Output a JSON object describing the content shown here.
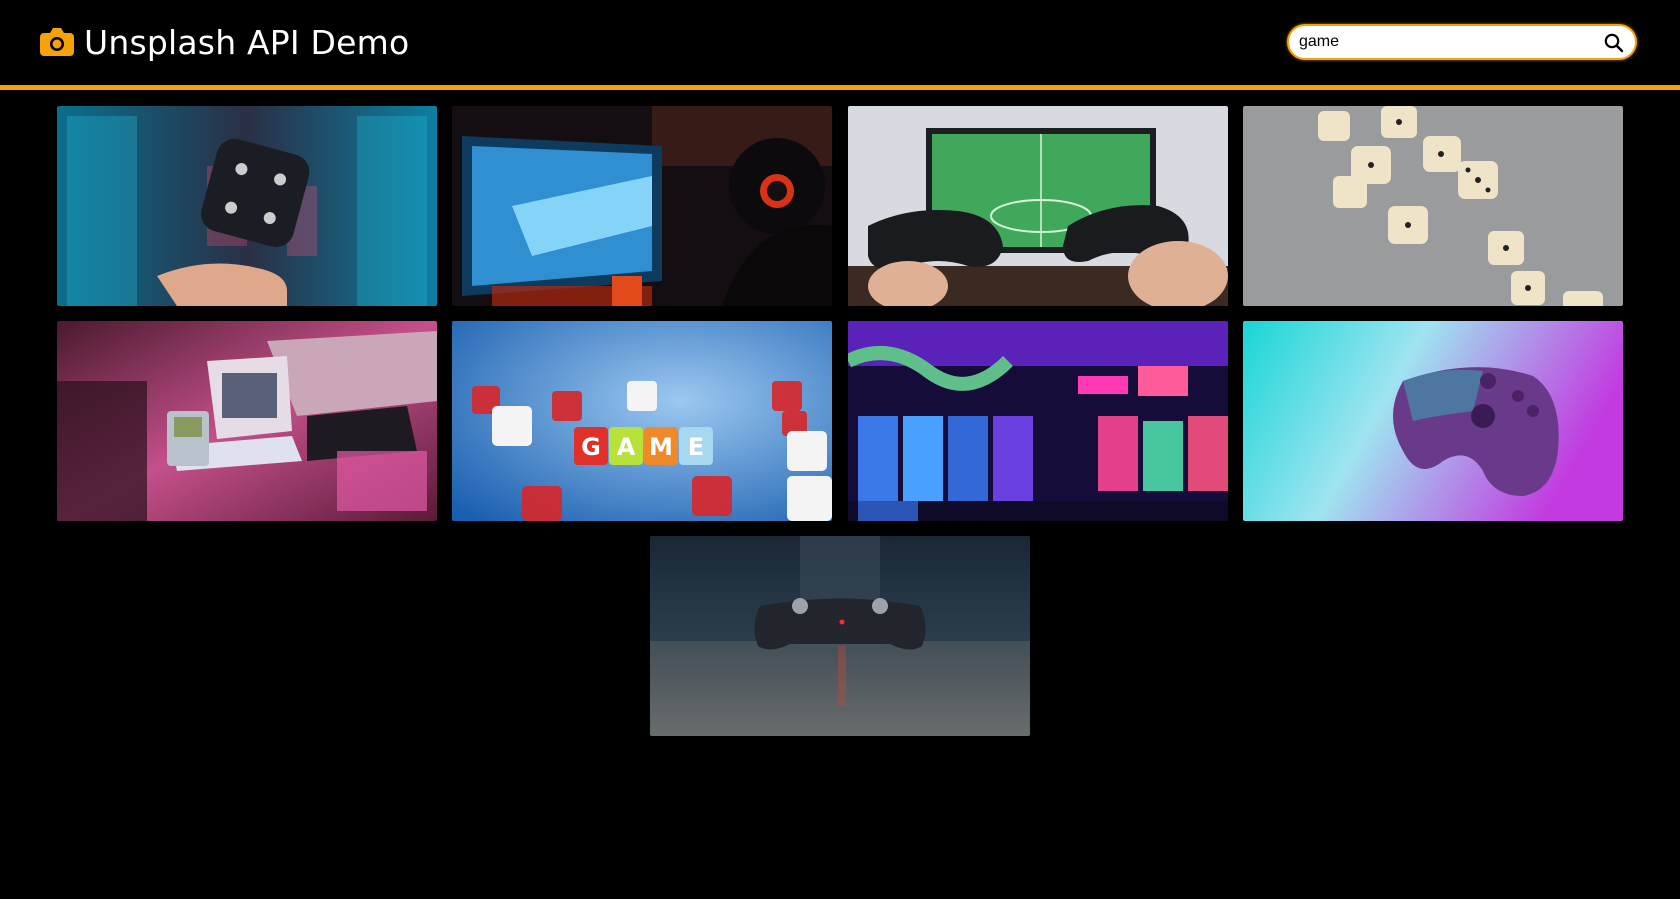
{
  "app": {
    "title": "Unsplash API Demo",
    "brand_icon": "camera-icon",
    "accent_color": "#f5a20a",
    "background_color": "#000000"
  },
  "search": {
    "value": "game",
    "icon": "search-icon"
  },
  "results": {
    "count": 9,
    "photos": [
      {
        "id": "p1",
        "subject": "dice-over-hand-neon"
      },
      {
        "id": "p2",
        "subject": "gamer-headset-monitor"
      },
      {
        "id": "p3",
        "subject": "two-controllers-football-tv"
      },
      {
        "id": "p4",
        "subject": "falling-dice-grey"
      },
      {
        "id": "p5",
        "subject": "retro-computers-pink"
      },
      {
        "id": "p6",
        "subject": "game-letter-dice-blue"
      },
      {
        "id": "p7",
        "subject": "arcade-hall-neon"
      },
      {
        "id": "p8",
        "subject": "controller-cyan-magenta"
      },
      {
        "id": "p9",
        "subject": "controller-dark-table"
      }
    ]
  }
}
